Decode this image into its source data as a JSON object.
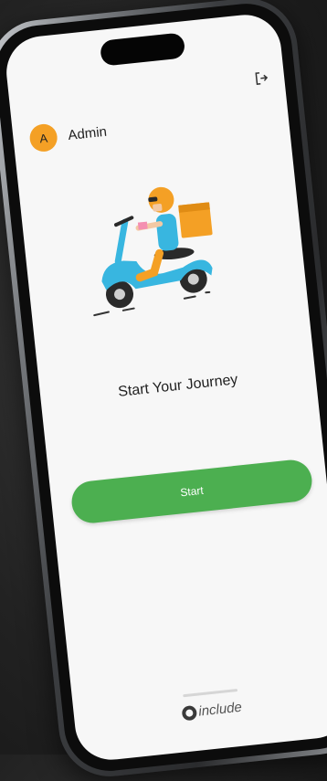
{
  "user": {
    "avatar_letter": "A",
    "name": "Admin"
  },
  "main": {
    "title": "Start Your Journey",
    "start_label": "Start"
  },
  "footer": {
    "brand": "include"
  },
  "icons": {
    "logout": "logout-icon",
    "illustration": "delivery-scooter-illustration"
  },
  "colors": {
    "accent": "#4caf50",
    "avatar": "#f4a025",
    "background": "#f7f7f7"
  }
}
